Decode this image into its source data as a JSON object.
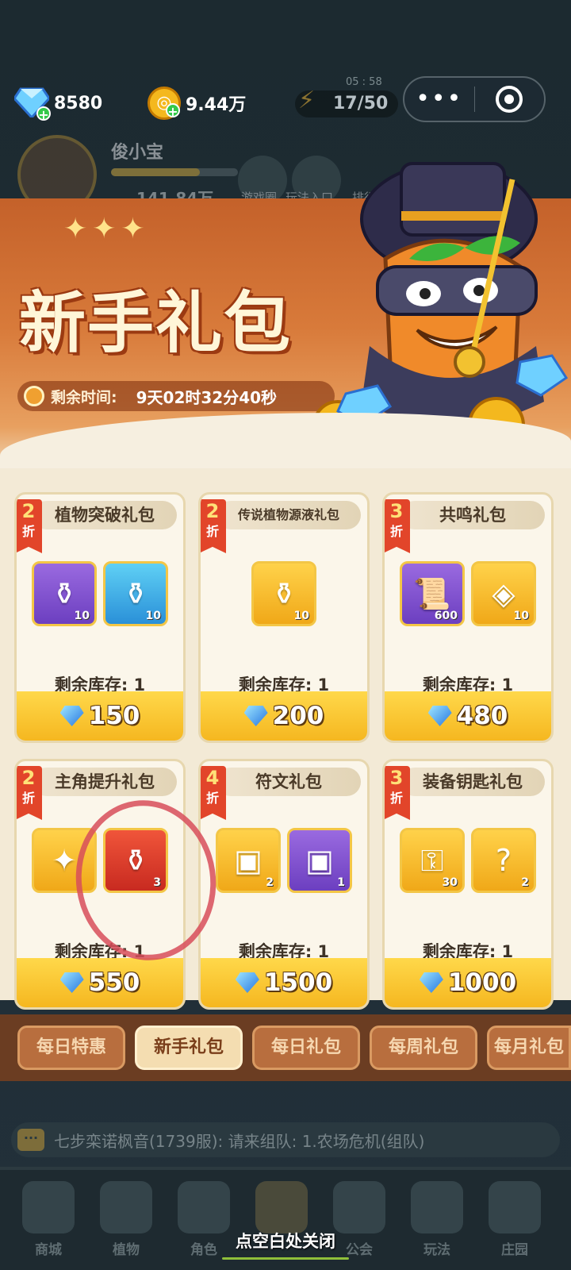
{
  "resources": {
    "diamonds": "8580",
    "coins": "9.44万",
    "energy": "17/50",
    "energy_timer": "05 : 58"
  },
  "capsule": {
    "more_icon": "more-dots-icon",
    "close_icon": "close-ring-icon",
    "more_glyph": "•••"
  },
  "profile": {
    "name": "俊小宝",
    "power": "141.84万",
    "exp_fraction": 0.7,
    "menu": [
      "游戏圈",
      "玩法入口",
      "排行榜"
    ]
  },
  "banner": {
    "title": "新手礼包",
    "timer_label": "剩余时间:",
    "timer_value": "9天02时32分40秒"
  },
  "discount_suffix": "折",
  "stock_label": "剩余库存: 1",
  "packs": [
    {
      "title": "植物突破礼包",
      "discount": "2",
      "price": "150",
      "items": [
        {
          "color": "purple",
          "icon": "purple-potion-icon",
          "count": "10",
          "glyph": "⚱"
        },
        {
          "color": "blue",
          "icon": "blue-potion-icon",
          "count": "10",
          "glyph": "⚱"
        }
      ]
    },
    {
      "title": "传说植物源液礼包",
      "discount": "2",
      "price": "200",
      "items": [
        {
          "color": "gold",
          "icon": "orange-potion-icon",
          "count": "10",
          "glyph": "⚱"
        }
      ]
    },
    {
      "title": "共鸣礼包",
      "discount": "3",
      "price": "480",
      "items": [
        {
          "color": "purple",
          "icon": "scroll-icon",
          "count": "600",
          "glyph": "📜"
        },
        {
          "color": "gold",
          "icon": "rune-stone-icon",
          "count": "10",
          "glyph": "◈"
        }
      ]
    },
    {
      "title": "主角提升礼包",
      "discount": "2",
      "price": "550",
      "items": [
        {
          "color": "gold",
          "icon": "purple-scroll-icon",
          "count": "",
          "glyph": "✦"
        },
        {
          "color": "red",
          "icon": "red-bottle-icon",
          "count": "3",
          "glyph": "⚱"
        }
      ]
    },
    {
      "title": "符文礼包",
      "discount": "4",
      "price": "1500",
      "items": [
        {
          "color": "gold",
          "icon": "green-chest-icon",
          "count": "2",
          "glyph": "▣"
        },
        {
          "color": "purple",
          "icon": "purple-chest-icon",
          "count": "1",
          "glyph": "▣"
        }
      ]
    },
    {
      "title": "装备钥匙礼包",
      "discount": "3",
      "price": "1000",
      "items": [
        {
          "color": "gold",
          "icon": "golden-key-icon",
          "count": "30",
          "glyph": "⚿"
        },
        {
          "color": "gold",
          "icon": "mystery-crystal-icon",
          "count": "2",
          "glyph": "?"
        }
      ]
    }
  ],
  "tabs": [
    "每日特惠",
    "新手礼包",
    "每日礼包",
    "每周礼包",
    "每月礼包"
  ],
  "active_tab": 1,
  "chat": {
    "message": "七步栾诺枫音(1739服): 请来组队: 1.农场危机(组队)",
    "icon_glyph": "···"
  },
  "bottom_nav": [
    "商城",
    "植物",
    "角色",
    "",
    "公会",
    "玩法",
    "庄园"
  ],
  "close_hint": "点空白处关闭"
}
